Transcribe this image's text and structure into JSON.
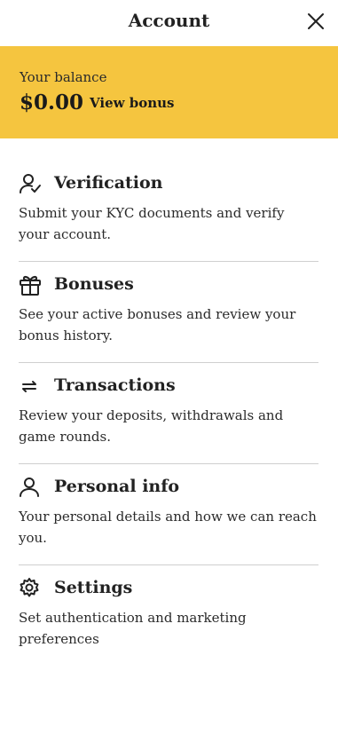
{
  "header": {
    "title": "Account"
  },
  "balance": {
    "label": "Your balance",
    "amount": "$0.00",
    "view_bonus": "View bonus",
    "background": "#f5c53f"
  },
  "menu": [
    {
      "icon": "user-check-icon",
      "title": "Verification",
      "description": "Submit your KYC documents and verify your account."
    },
    {
      "icon": "gift-icon",
      "title": "Bonuses",
      "description": "See your active bonuses and review your bonus history."
    },
    {
      "icon": "arrows-swap-icon",
      "title": "Transactions",
      "description": "Review your deposits, withdrawals and game rounds."
    },
    {
      "icon": "user-icon",
      "title": "Personal info",
      "description": "Your personal details and how we can reach you."
    },
    {
      "icon": "gear-icon",
      "title": "Settings",
      "description": "Set authentication and marketing preferences"
    }
  ]
}
